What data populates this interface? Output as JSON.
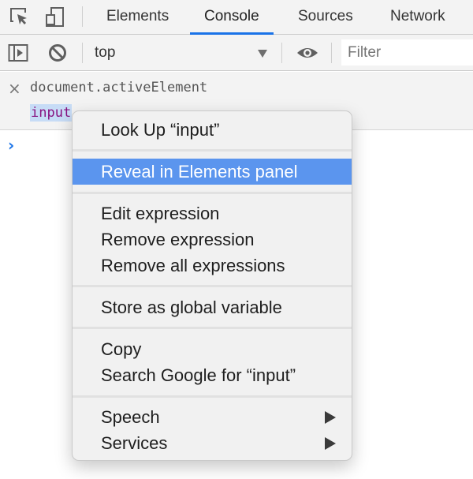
{
  "tabbar": {
    "icons": [
      "inspect-element-icon",
      "device-toolbar-icon"
    ],
    "tabs": [
      {
        "label": "Elements",
        "active": false
      },
      {
        "label": "Console",
        "active": true
      },
      {
        "label": "Sources",
        "active": false
      },
      {
        "label": "Network",
        "active": false
      }
    ],
    "accent_color": "#1a73e8"
  },
  "toolbar": {
    "icons": [
      "show-sidebar-icon",
      "clear-console-icon",
      "live-expression-eye-icon"
    ],
    "context_value": "top",
    "filter_placeholder": "Filter",
    "filter_value": ""
  },
  "live_expression": {
    "close_symbol": "×",
    "expression": "document.activeElement",
    "result": "input",
    "result_color": "#881280"
  },
  "console": {
    "prompt_symbol": "›"
  },
  "context_menu": {
    "highlight_color": "#5b95ee",
    "groups": [
      [
        {
          "label": "Look Up “input”"
        }
      ],
      [
        {
          "label": "Reveal in Elements panel",
          "highlighted": true
        }
      ],
      [
        {
          "label": "Edit expression"
        },
        {
          "label": "Remove expression"
        },
        {
          "label": "Remove all expressions"
        }
      ],
      [
        {
          "label": "Store as global variable"
        }
      ],
      [
        {
          "label": "Copy"
        },
        {
          "label": "Search Google for “input”"
        }
      ],
      [
        {
          "label": "Speech",
          "submenu": true
        },
        {
          "label": "Services",
          "submenu": true
        }
      ]
    ]
  }
}
